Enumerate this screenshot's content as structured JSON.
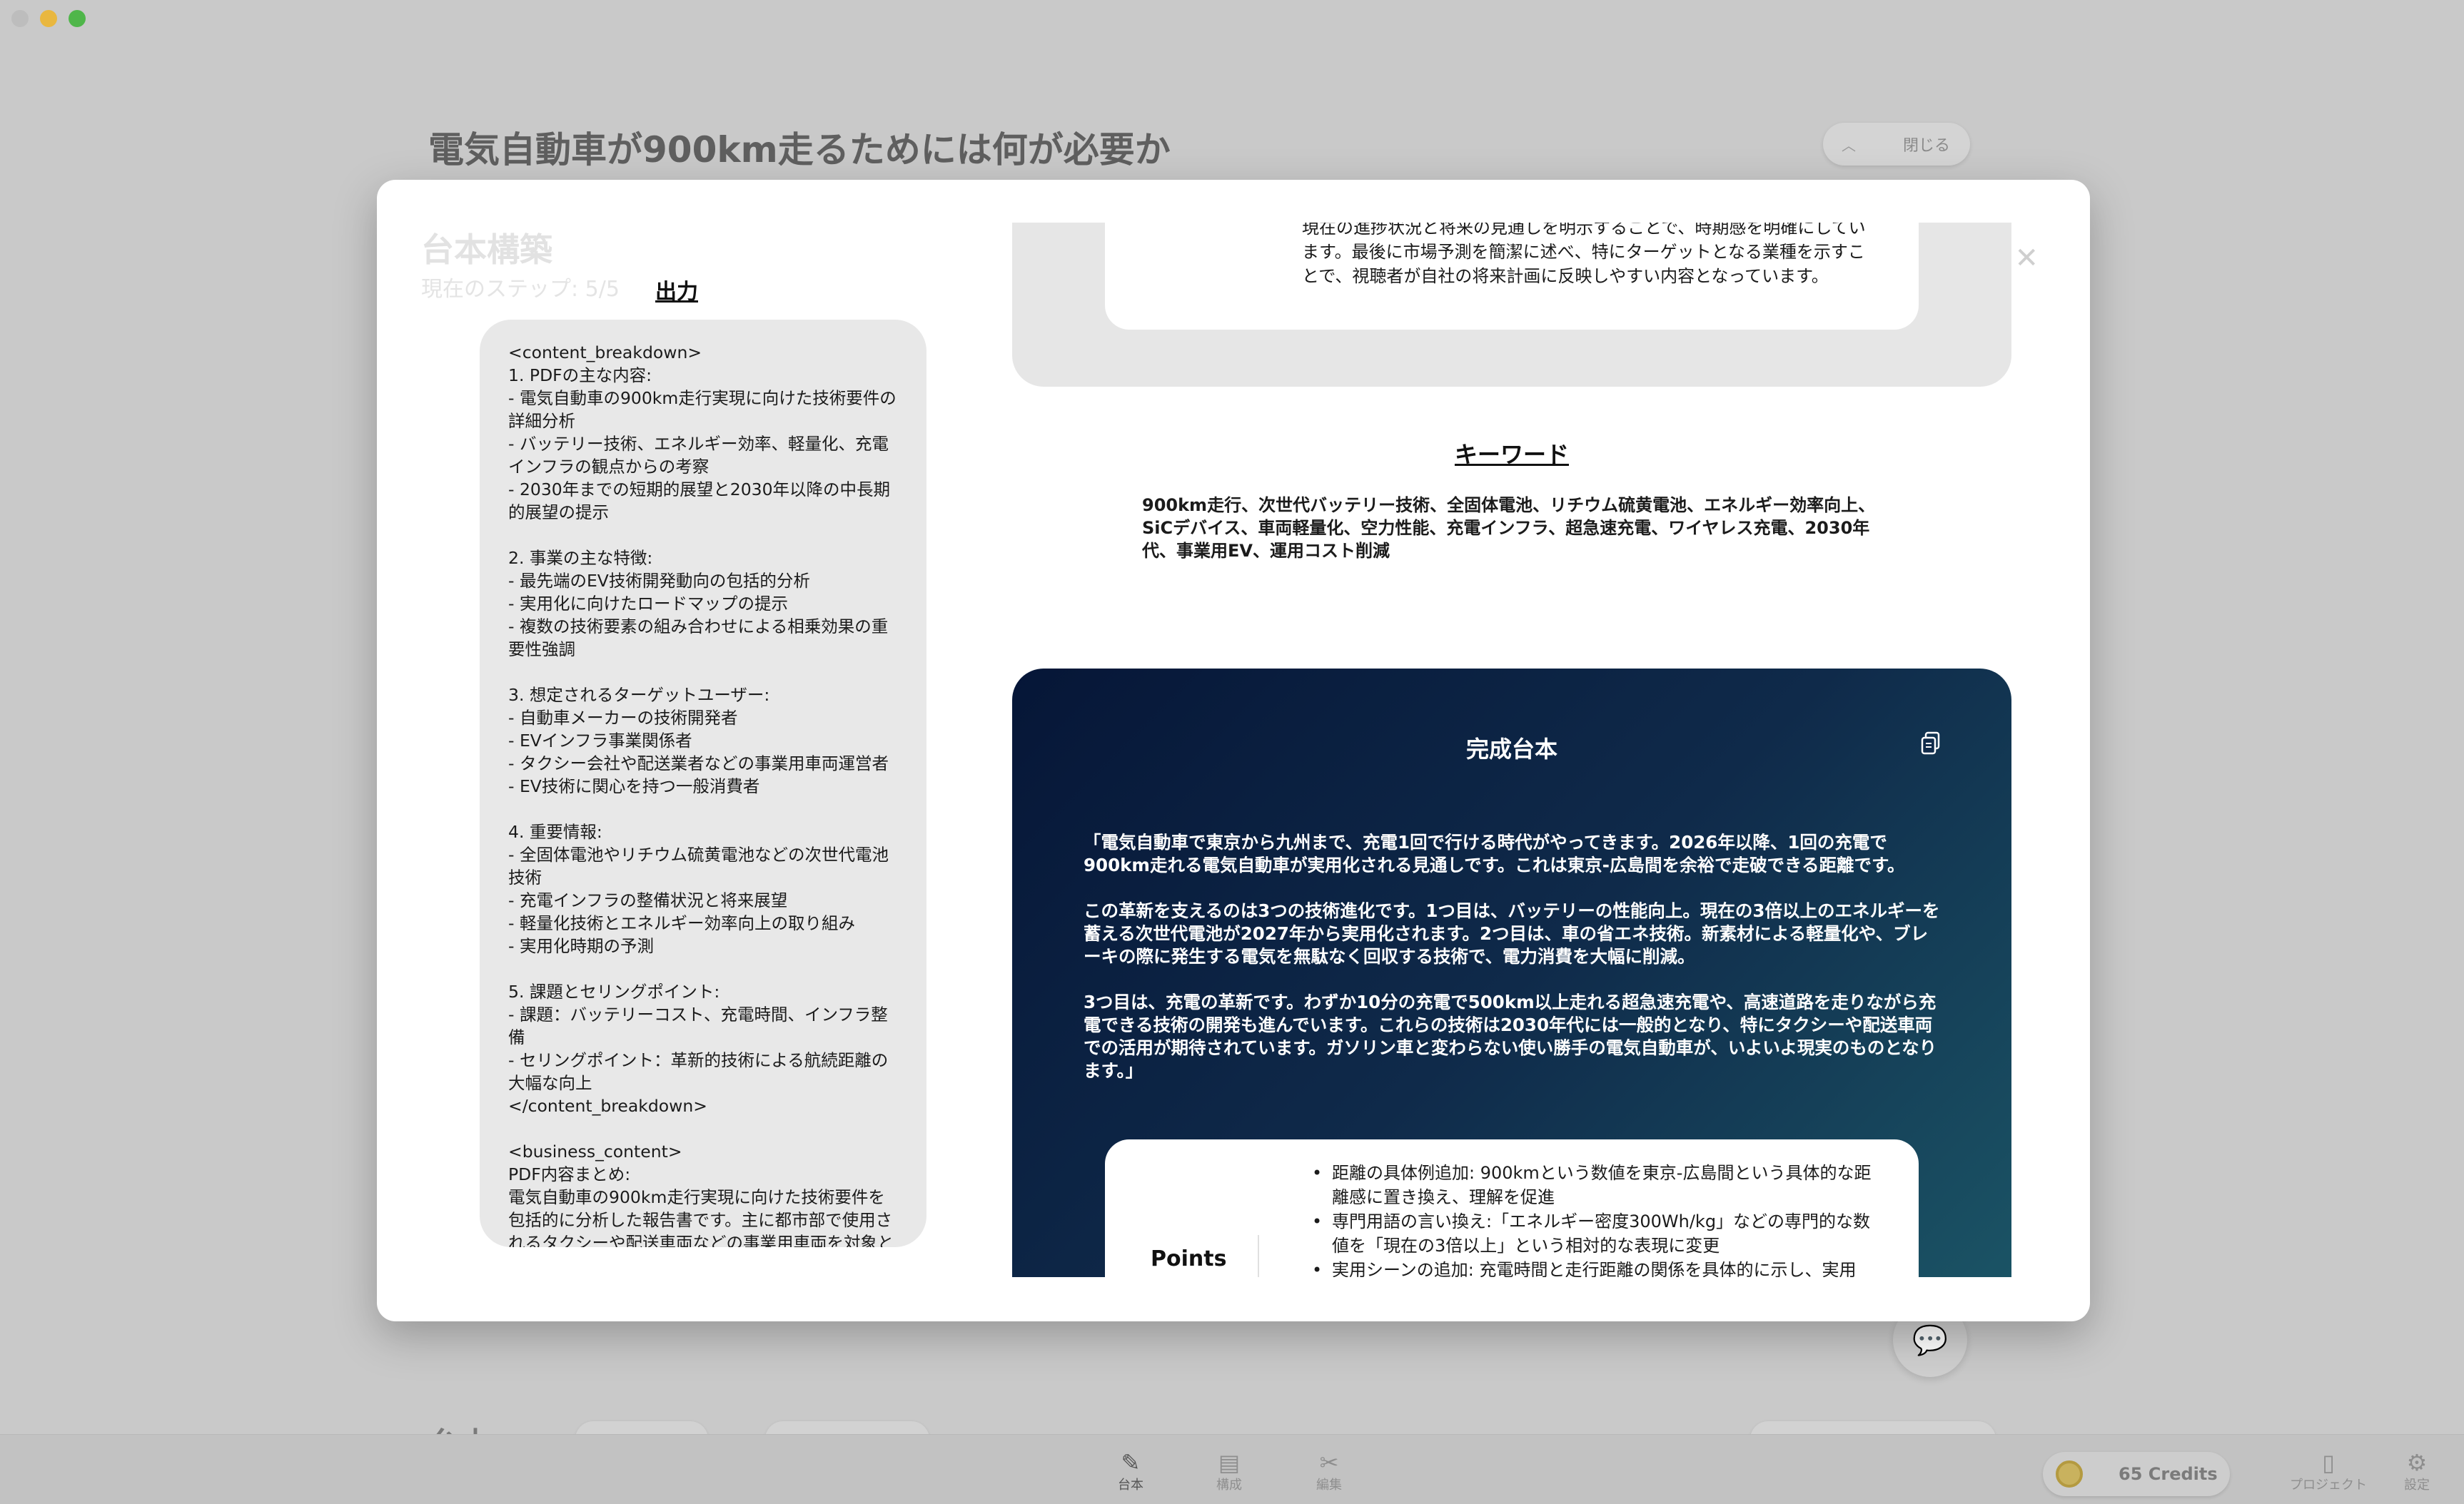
{
  "background": {
    "page_title": "電気自動車が900km走るためには何が必要か",
    "close_button_label": "閉じる",
    "peek_title": "台本",
    "bottom_nav": [
      {
        "label": "台本",
        "icon": "pencil-icon"
      },
      {
        "label": "構成",
        "icon": "film-icon"
      },
      {
        "label": "編集",
        "icon": "scissors-icon"
      }
    ],
    "credits_label": "65 Credits",
    "project_label": "プロジェクト",
    "settings_label": "設定"
  },
  "modal": {
    "title": "台本構築",
    "step": "現在のステップ: 5/5",
    "output_heading": "出力",
    "output_text": "<content_breakdown>\n1. PDFの主な内容:\n- 電気自動車の900km走行実現に向けた技術要件の詳細分析\n- バッテリー技術、エネルギー効率、軽量化、充電インフラの観点からの考察\n- 2030年までの短期的展望と2030年以降の中長期的展望の提示\n\n2. 事業の主な特徴:\n- 最先端のEV技術開発動向の包括的分析\n- 実用化に向けたロードマップの提示\n- 複数の技術要素の組み合わせによる相乗効果の重要性強調\n\n3. 想定されるターゲットユーザー:\n- 自動車メーカーの技術開発者\n- EVインフラ事業関係者\n- タクシー会社や配送業者などの事業用車両運営者\n- EV技術に関心を持つ一般消費者\n\n4. 重要情報:\n- 全固体電池やリチウム硫黄電池などの次世代電池技術\n- 充電インフラの整備状況と将来展望\n- 軽量化技術とエネルギー効率向上の取り組み\n- 実用化時期の予測\n\n5. 課題とセリングポイント:\n- 課題：バッテリーコスト、充電時間、インフラ整備\n- セリングポイント：革新的技術による航続距離の大幅な向上\n</content_breakdown>\n\n<business_content>\nPDF内容まとめ:\n電気自動車の900km走行実現に向けた技術要件を包括的に分析した報告書です。主に都市部で使用されるタクシーや配送車両などの事業用車両を対象とし、バッテリー技術、エネルギー効率向上、車両軽量化、充電インフラの各側面から実現可能性を検討しています。",
    "top_card_text": "現在の進捗状況と将来の見通しを明示することで、時期感を明確にしています。最後に市場予測を簡潔に述べ、特にターゲットとなる業種を示すことで、視聴者が自社の将来計画に反映しやすい内容となっています。",
    "keywords_heading": "キーワード",
    "keywords_text": "900km走行、次世代バッテリー技術、全固体電池、リチウム硫黄電池、エネルギー効率向上、SiCデバイス、車両軽量化、空力性能、充電インフラ、超急速充電、ワイヤレス充電、2030年代、事業用EV、運用コスト削減",
    "script_heading": "完成台本",
    "script_paragraphs": [
      "「電気自動車で東京から九州まで、充電1回で行ける時代がやってきます。2026年以降、1回の充電で900km走れる電気自動車が実用化される見通しです。これは東京-広島間を余裕で走破できる距離です。",
      "この革新を支えるのは3つの技術進化です。1つ目は、バッテリーの性能向上。現在の3倍以上のエネルギーを蓄える次世代電池が2027年から実用化されます。2つ目は、車の省エネ技術。新素材による軽量化や、ブレーキの際に発生する電気を無駄なく回収する技術で、電力消費を大幅に削減。",
      "3つ目は、充電の革新です。わずか10分の充電で500km以上走れる超急速充電や、高速道路を走りながら充電できる技術の開発も進んでいます。これらの技術は2030年代には一般的となり、特にタクシーや配送車両での活用が期待されています。ガソリン車と変わらない使い勝手の電気自動車が、いよいよ現実のものとなります。」"
    ],
    "points_label": "Points",
    "points": [
      "距離の具体例追加: 900kmという数値を東京-広島間という具体的な距離感に置き換え、理解を促進",
      "専門用語の言い換え:「エネルギー密度300Wh/kg」などの専門的な数値を「現在の3倍以上」という相対的な表現に変更",
      "実用シーンの追加: 充電時間と走行距離の関係を具体的に示し、実用"
    ]
  }
}
